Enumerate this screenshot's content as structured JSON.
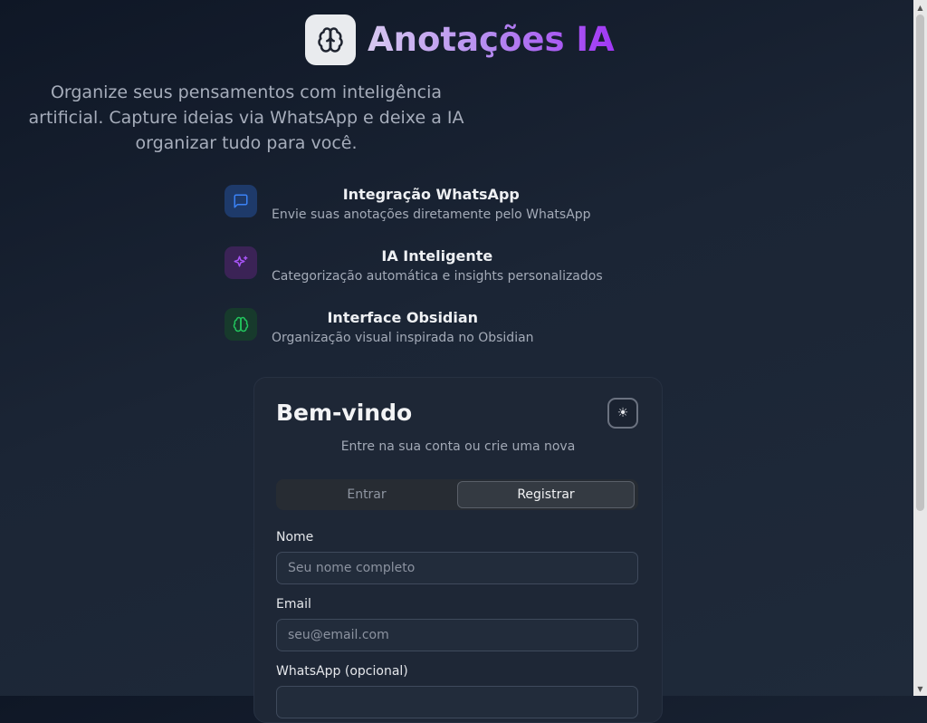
{
  "app": {
    "title": "Anotações IA",
    "tagline": "Organize seus pensamentos com inteligência artificial. Capture ideias via WhatsApp e deixe a IA organizar tudo para você."
  },
  "features": [
    {
      "title": "Integração WhatsApp",
      "description": "Envie suas anotações diretamente pelo WhatsApp",
      "icon": "message-square-icon",
      "color": "#3b82f6"
    },
    {
      "title": "IA Inteligente",
      "description": "Categorização automática e insights personalizados",
      "icon": "sparkles-icon",
      "color": "#a855f7"
    },
    {
      "title": "Interface Obsidian",
      "description": "Organização visual inspirada no Obsidian",
      "icon": "brain-icon",
      "color": "#22c55e"
    }
  ],
  "auth": {
    "title": "Bem-vindo",
    "subtitle": "Entre na sua conta ou crie uma nova",
    "theme_toggle": "☀",
    "tabs": {
      "login": "Entrar",
      "register": "Registrar",
      "active": "register"
    },
    "fields": {
      "name": {
        "label": "Nome",
        "placeholder": "Seu nome completo",
        "value": ""
      },
      "email": {
        "label": "Email",
        "placeholder": "seu@email.com",
        "value": ""
      },
      "whatsapp": {
        "label": "WhatsApp (opcional)",
        "placeholder": "",
        "value": ""
      }
    }
  },
  "colors": {
    "accent_gradient_start": "#d7c8f0",
    "accent_gradient_end": "#a137f5",
    "background": "#1b2535",
    "card": "#1e2736"
  }
}
